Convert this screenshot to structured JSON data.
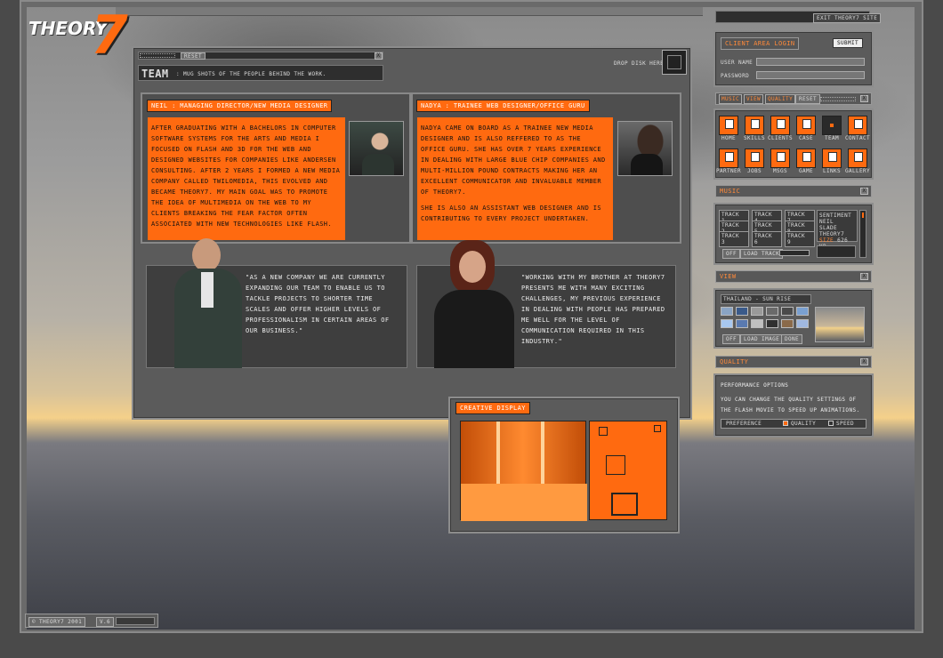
{
  "brand": {
    "name": "Theory",
    "number": "7"
  },
  "header": {
    "exit_label": "Exit Theory7 Site",
    "drop_disk_label": "Drop disk here"
  },
  "window": {
    "reset_label": "Reset",
    "title": "Team",
    "subtitle": ": Mug shots of the people behind the work."
  },
  "team": [
    {
      "title": "Neil : Managing Director/New Media Designer",
      "bio": "After graduating with a Bachelors in Computer Software Systems for the Arts and Media I focused on Flash and 3D for the web and designed websites for companies like Andersen Consulting.  After 2 years I formed a new media company called Twilomedia, this evolved and became Theory7.  My main goal was to promote the idea of multimedia on the web to my clients breaking the fear factor often associated with new technologies like Flash.",
      "quote": "\"As a new company we are currently expanding our team to enable us to tackle projects to shorter time scales and offer higher levels of professionalism in certain areas of our business.\""
    },
    {
      "title": "Nadya : Trainee Web Designer/Office Guru",
      "bio": "Nadya came on board as a trainee new media designer and is also reffered to as the office guru. She has over 7 years experience in dealing with large blue chip companies and multi-million pound contracts making her an excellent communicator and invaluable member of Theory7.",
      "bio2": "She is also an assistant web designer and is contributing to every project undertaken.",
      "quote": "\"Working with my brother at Theory7 presents me with many exciting challenges, my previous experience in dealing with people has prepared me well for the level of communication required in this industry.\""
    }
  ],
  "creative": {
    "title": "Creative Display"
  },
  "login": {
    "title": "Client Area Login",
    "submit": "Submit",
    "user_label": "User name",
    "pass_label": "Password",
    "user_value": "",
    "pass_value": ""
  },
  "toolbar": {
    "tabs": [
      "Music",
      "View",
      "Quality"
    ],
    "reset": "Reset"
  },
  "nav": {
    "row1": [
      "Home",
      "Skills",
      "Clients",
      "Case",
      "Team",
      "Contact"
    ],
    "row2": [
      "Partner",
      "Jobs",
      "Msgs",
      "Game",
      "Links",
      "Gallery"
    ],
    "selected": "Team"
  },
  "music": {
    "header": "Music",
    "tracks": [
      "Track 1",
      "Track 2",
      "Track 3",
      "Track 4",
      "Track 5",
      "Track 6",
      "Track 7",
      "Track 8",
      "Track 9"
    ],
    "now_playing_1": "Sentiment",
    "now_playing_2": "Neil Slade",
    "now_playing_3": "Theory7",
    "size_label": "Size",
    "size_value": "626 kb",
    "off": "Off",
    "load": "Load Track"
  },
  "view": {
    "header": "View",
    "current": "Thailand - Sun Rise",
    "off": "Off",
    "load": "Load image",
    "done": "Done"
  },
  "quality": {
    "header": "Quality",
    "perf_title": "Performance Options",
    "perf_desc": "You can change the quality settings of the flash movie to speed up animations.",
    "preference": "Preference",
    "opt_quality": "Quality",
    "opt_speed": "Speed"
  },
  "footer": {
    "copyright": "© Theory7 2001",
    "version": "V.6"
  },
  "colors": {
    "accent": "#ff6a10",
    "panel": "#5b5b5b"
  }
}
